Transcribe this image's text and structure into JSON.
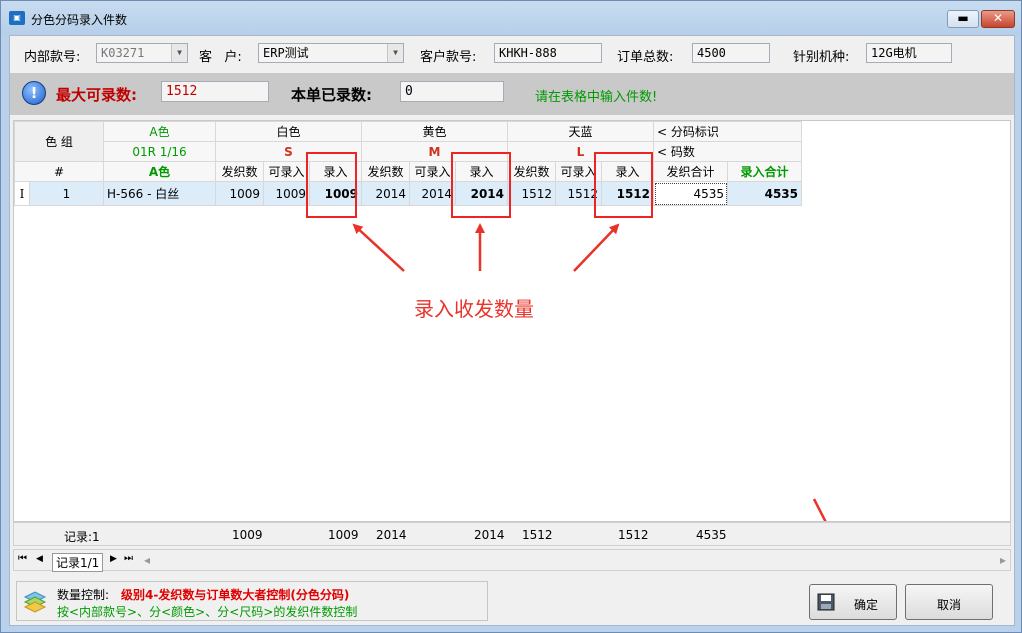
{
  "window": {
    "title": "分色分码录入件数",
    "minimize": "▬",
    "close": "✕"
  },
  "header": {
    "internal_no_label": "内部款号:",
    "internal_no_value": "K03271",
    "customer_label": "客   户:",
    "customer_value": "ERP测试",
    "customer_style_label": "客户款号:",
    "customer_style_value": "KHKH-888",
    "order_total_label": "订单总数:",
    "order_total_value": "4500",
    "machine_label": "针别机种:",
    "machine_value": "12G电机"
  },
  "entry_bar": {
    "max_label": "最大可录数:",
    "max_value": "1512",
    "entered_label": "本单已录数:",
    "entered_value": "0",
    "hint": "请在表格中输入件数!"
  },
  "grid": {
    "group_header": "色 组",
    "color_a": "A色",
    "color_a_sub": "01R 1/16",
    "colors": [
      "白色",
      "黄色",
      "天蓝"
    ],
    "sizes": [
      "S",
      "M",
      "L"
    ],
    "marker_label": "< 分码标识",
    "size_label": "< 码数",
    "index_header": "#",
    "color_col_header": "A色",
    "col_issued": "发织数",
    "col_available": "可录入",
    "col_entry": "录入",
    "col_issued_total": "发织合计",
    "col_entry_total": "录入合计",
    "row": {
      "cursor": "I",
      "index": "1",
      "color": "H-566 - 白丝",
      "s_issued": "1009",
      "s_available": "1009",
      "s_entry": "1009",
      "m_issued": "2014",
      "m_available": "2014",
      "m_entry": "2014",
      "l_issued": "1512",
      "l_available": "1512",
      "l_entry": "1512",
      "issued_total": "4535",
      "entry_total": "4535"
    }
  },
  "summary": {
    "records": "记录:1",
    "s_issued": "1009",
    "s_entry": "1009",
    "m_issued": "2014",
    "m_entry": "2014",
    "l_issued": "1512",
    "l_entry": "1512",
    "issued_total": "4535"
  },
  "navbar": {
    "first": "⏮",
    "prev": "◀",
    "label": "记录1/1",
    "next": "▶",
    "last": "⏭",
    "scroll_left": "◂",
    "scroll_right": "▸"
  },
  "footer": {
    "control_label": "数量控制:",
    "control_value": "级别4-发织数与订单数大者控制(分色分码)",
    "control_desc": "按<内部款号>、分<颜色>、分<尺码>的发织件数控制"
  },
  "buttons": {
    "ok": "确定",
    "cancel": "取消"
  },
  "annotation": {
    "text": "录入收发数量"
  },
  "colors": {
    "red_label": "#c00000",
    "green_text": "#009a00",
    "selected_row": "#dcecf8",
    "annotation_red": "#e9322a"
  }
}
